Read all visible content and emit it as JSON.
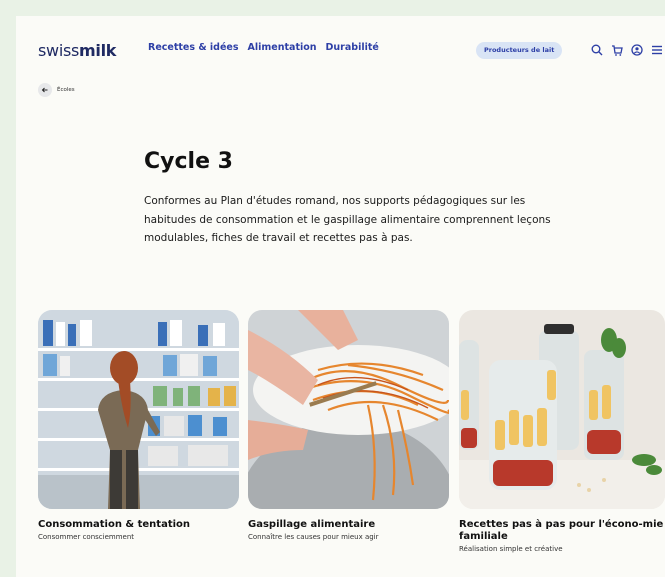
{
  "header": {
    "logo_light": "swiss",
    "logo_bold": "milk",
    "nav": [
      "Recettes & idées",
      "Alimentation",
      "Durabilité"
    ],
    "producer_button": "Producteurs de lait",
    "icons": [
      "search-icon",
      "cart-icon",
      "account-icon",
      "menu-icon"
    ]
  },
  "back": {
    "label": "Écoles"
  },
  "main": {
    "title": "Cycle 3",
    "intro": "Conformes au Plan d'études romand, nos supports pédagogiques sur les habitudes de consommation et le gaspillage alimentaire comprennent leçons modulables, fiches de travail et recettes pas à pas."
  },
  "cards": [
    {
      "title": "Consommation & tentation",
      "subtitle": "Consommer consciemment"
    },
    {
      "title": "Gaspillage alimentaire",
      "subtitle": "Connaître les causes pour mieux agir"
    },
    {
      "title": "Recettes pas à pas pour l'écono-mie familiale",
      "subtitle": "Réalisation simple et créative"
    }
  ],
  "colors": {
    "background": "#e9f2e6",
    "page": "#fbfbf7",
    "nav": "#2d3fa6",
    "logo": "#1f2a63"
  }
}
